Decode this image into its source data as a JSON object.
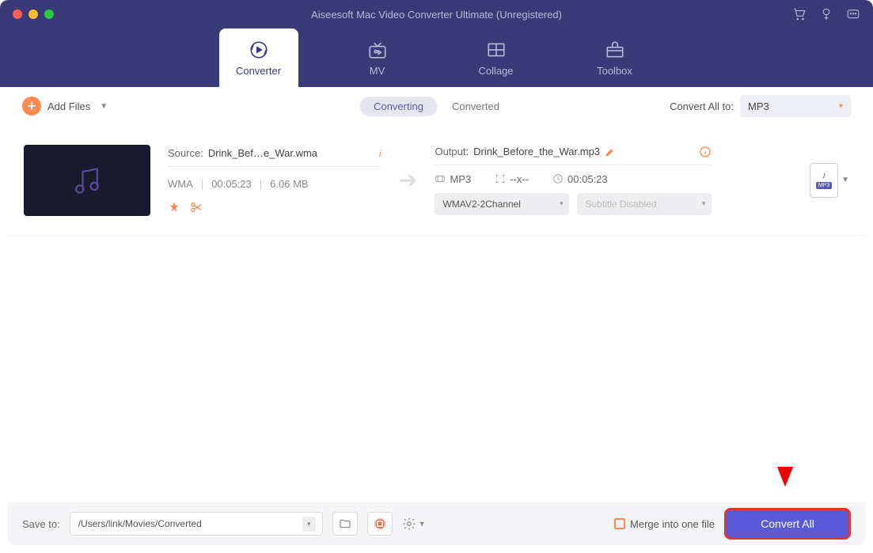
{
  "window": {
    "title": "Aiseesoft Mac Video Converter Ultimate (Unregistered)"
  },
  "nav": {
    "tabs": [
      {
        "label": "Converter"
      },
      {
        "label": "MV"
      },
      {
        "label": "Collage"
      },
      {
        "label": "Toolbox"
      }
    ]
  },
  "toolbar": {
    "add_label": "Add Files",
    "pill_converting": "Converting",
    "pill_converted": "Converted",
    "convert_all_label": "Convert All to:",
    "convert_all_format": "MP3"
  },
  "file": {
    "source_label": "Source:",
    "source_name": "Drink_Bef…e_War.wma",
    "format": "WMA",
    "duration": "00:05:23",
    "size": "6.06 MB",
    "output_label": "Output:",
    "output_name": "Drink_Before_the_War.mp3",
    "out_format": "MP3",
    "out_resolution": "--x--",
    "out_duration": "00:05:23",
    "audio_select": "WMAV2-2Channel",
    "subtitle_select": "Subtitle Disabled",
    "fmt_badge": "MP3"
  },
  "bottom": {
    "save_label": "Save to:",
    "save_path": "/Users/link/Movies/Converted",
    "merge_label": "Merge into one file",
    "convert_button": "Convert All"
  }
}
